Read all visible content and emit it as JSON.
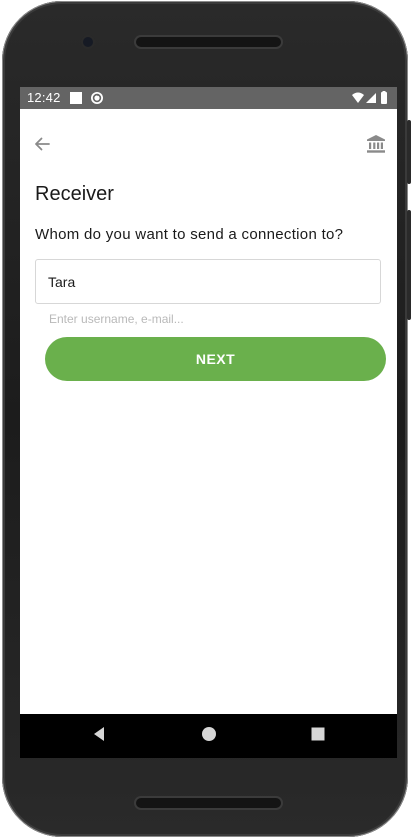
{
  "status_bar": {
    "time": "12:42",
    "icons": [
      "notification-square-icon",
      "sync-icon",
      "wifi-icon",
      "signal-icon",
      "battery-icon"
    ]
  },
  "app_bar": {
    "back_icon": "arrow-left-icon",
    "action_icon": "bank-icon"
  },
  "page": {
    "title": "Receiver",
    "question": "Whom do you want to send a connection to?"
  },
  "form": {
    "recipient_value": "Tara",
    "hint": "Enter username, e-mail..."
  },
  "actions": {
    "next_label": "NEXT"
  },
  "nav_bar": {
    "items": [
      "back-triangle-icon",
      "home-circle-icon",
      "recents-square-icon"
    ]
  },
  "colors": {
    "accent": "#6ab04c",
    "status_bar": "#646464",
    "nav_bar": "#000000",
    "icon_gray": "#8a8a8a"
  }
}
